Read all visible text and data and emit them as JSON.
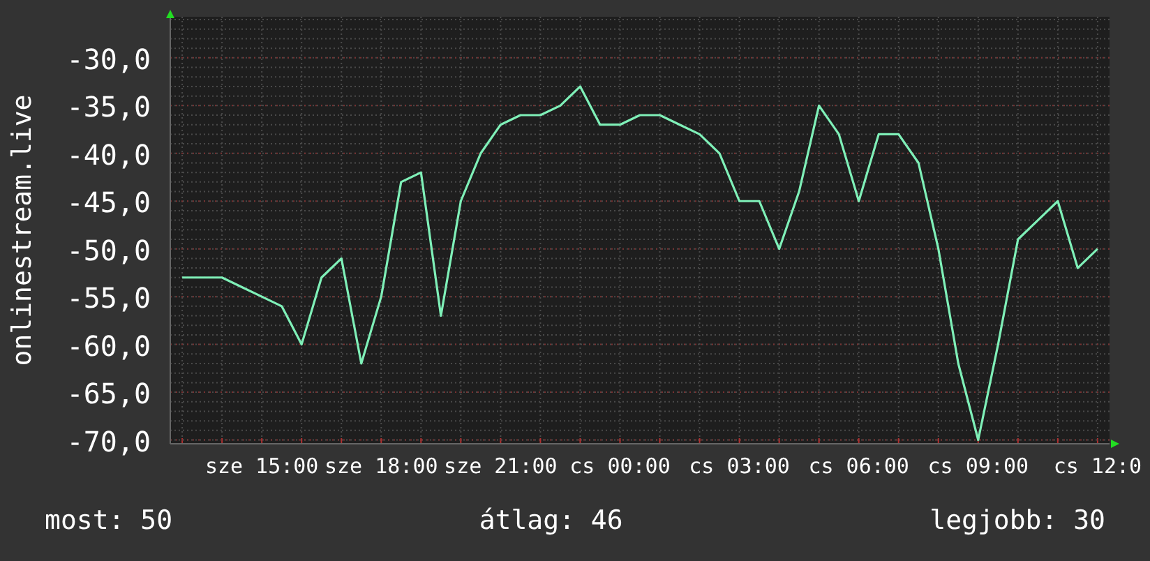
{
  "chart": {
    "chart_data": {
      "type": "line",
      "ylabel": "onlinestream.live",
      "categories": [
        null,
        null,
        null,
        null,
        "sze 15:00",
        null,
        null,
        null,
        null,
        null,
        "sze 18:00",
        null,
        null,
        null,
        null,
        null,
        "sze 21:00",
        null,
        null,
        null,
        null,
        null,
        "cs 00:00",
        null,
        null,
        null,
        null,
        null,
        "cs 03:00",
        null,
        null,
        null,
        null,
        null,
        "cs 06:00",
        null,
        null,
        null,
        null,
        null,
        "cs 09:00",
        null,
        null,
        null,
        null,
        null,
        "cs 12:0"
      ],
      "series": [
        {
          "color": "#7ff0b8",
          "values": [
            -53,
            -53,
            -53,
            -54,
            -55,
            -56,
            -60,
            -53,
            -51,
            -62,
            -55,
            -43,
            -42,
            -57,
            -45,
            -40,
            -37,
            -36,
            -36,
            -35,
            -33,
            -37,
            -37,
            -36,
            -36,
            -37,
            -38,
            -40,
            -45,
            -45,
            -50,
            -44,
            -35,
            -38,
            -45,
            -38,
            -38,
            -41,
            -50,
            -62,
            -70,
            -60,
            -49,
            -47,
            -45,
            -52,
            -50
          ]
        }
      ],
      "ylim": [
        -70.4,
        -25.7
      ],
      "grid": true,
      "yticks": [
        {
          "value": -30,
          "label": "-30,0"
        },
        {
          "value": -35,
          "label": "-35,0"
        },
        {
          "value": -40,
          "label": "-40,0"
        },
        {
          "value": -45,
          "label": "-45,0"
        },
        {
          "value": -50,
          "label": "-50,0"
        },
        {
          "value": -55,
          "label": "-55,0"
        },
        {
          "value": -60,
          "label": "-60,0"
        },
        {
          "value": -65,
          "label": "-65,0"
        },
        {
          "value": -70,
          "label": "-70,0"
        }
      ]
    }
  },
  "legend": [
    {
      "label": "most: 50"
    },
    {
      "label": "átlag: 46"
    },
    {
      "label": "legjobb: 30"
    }
  ]
}
